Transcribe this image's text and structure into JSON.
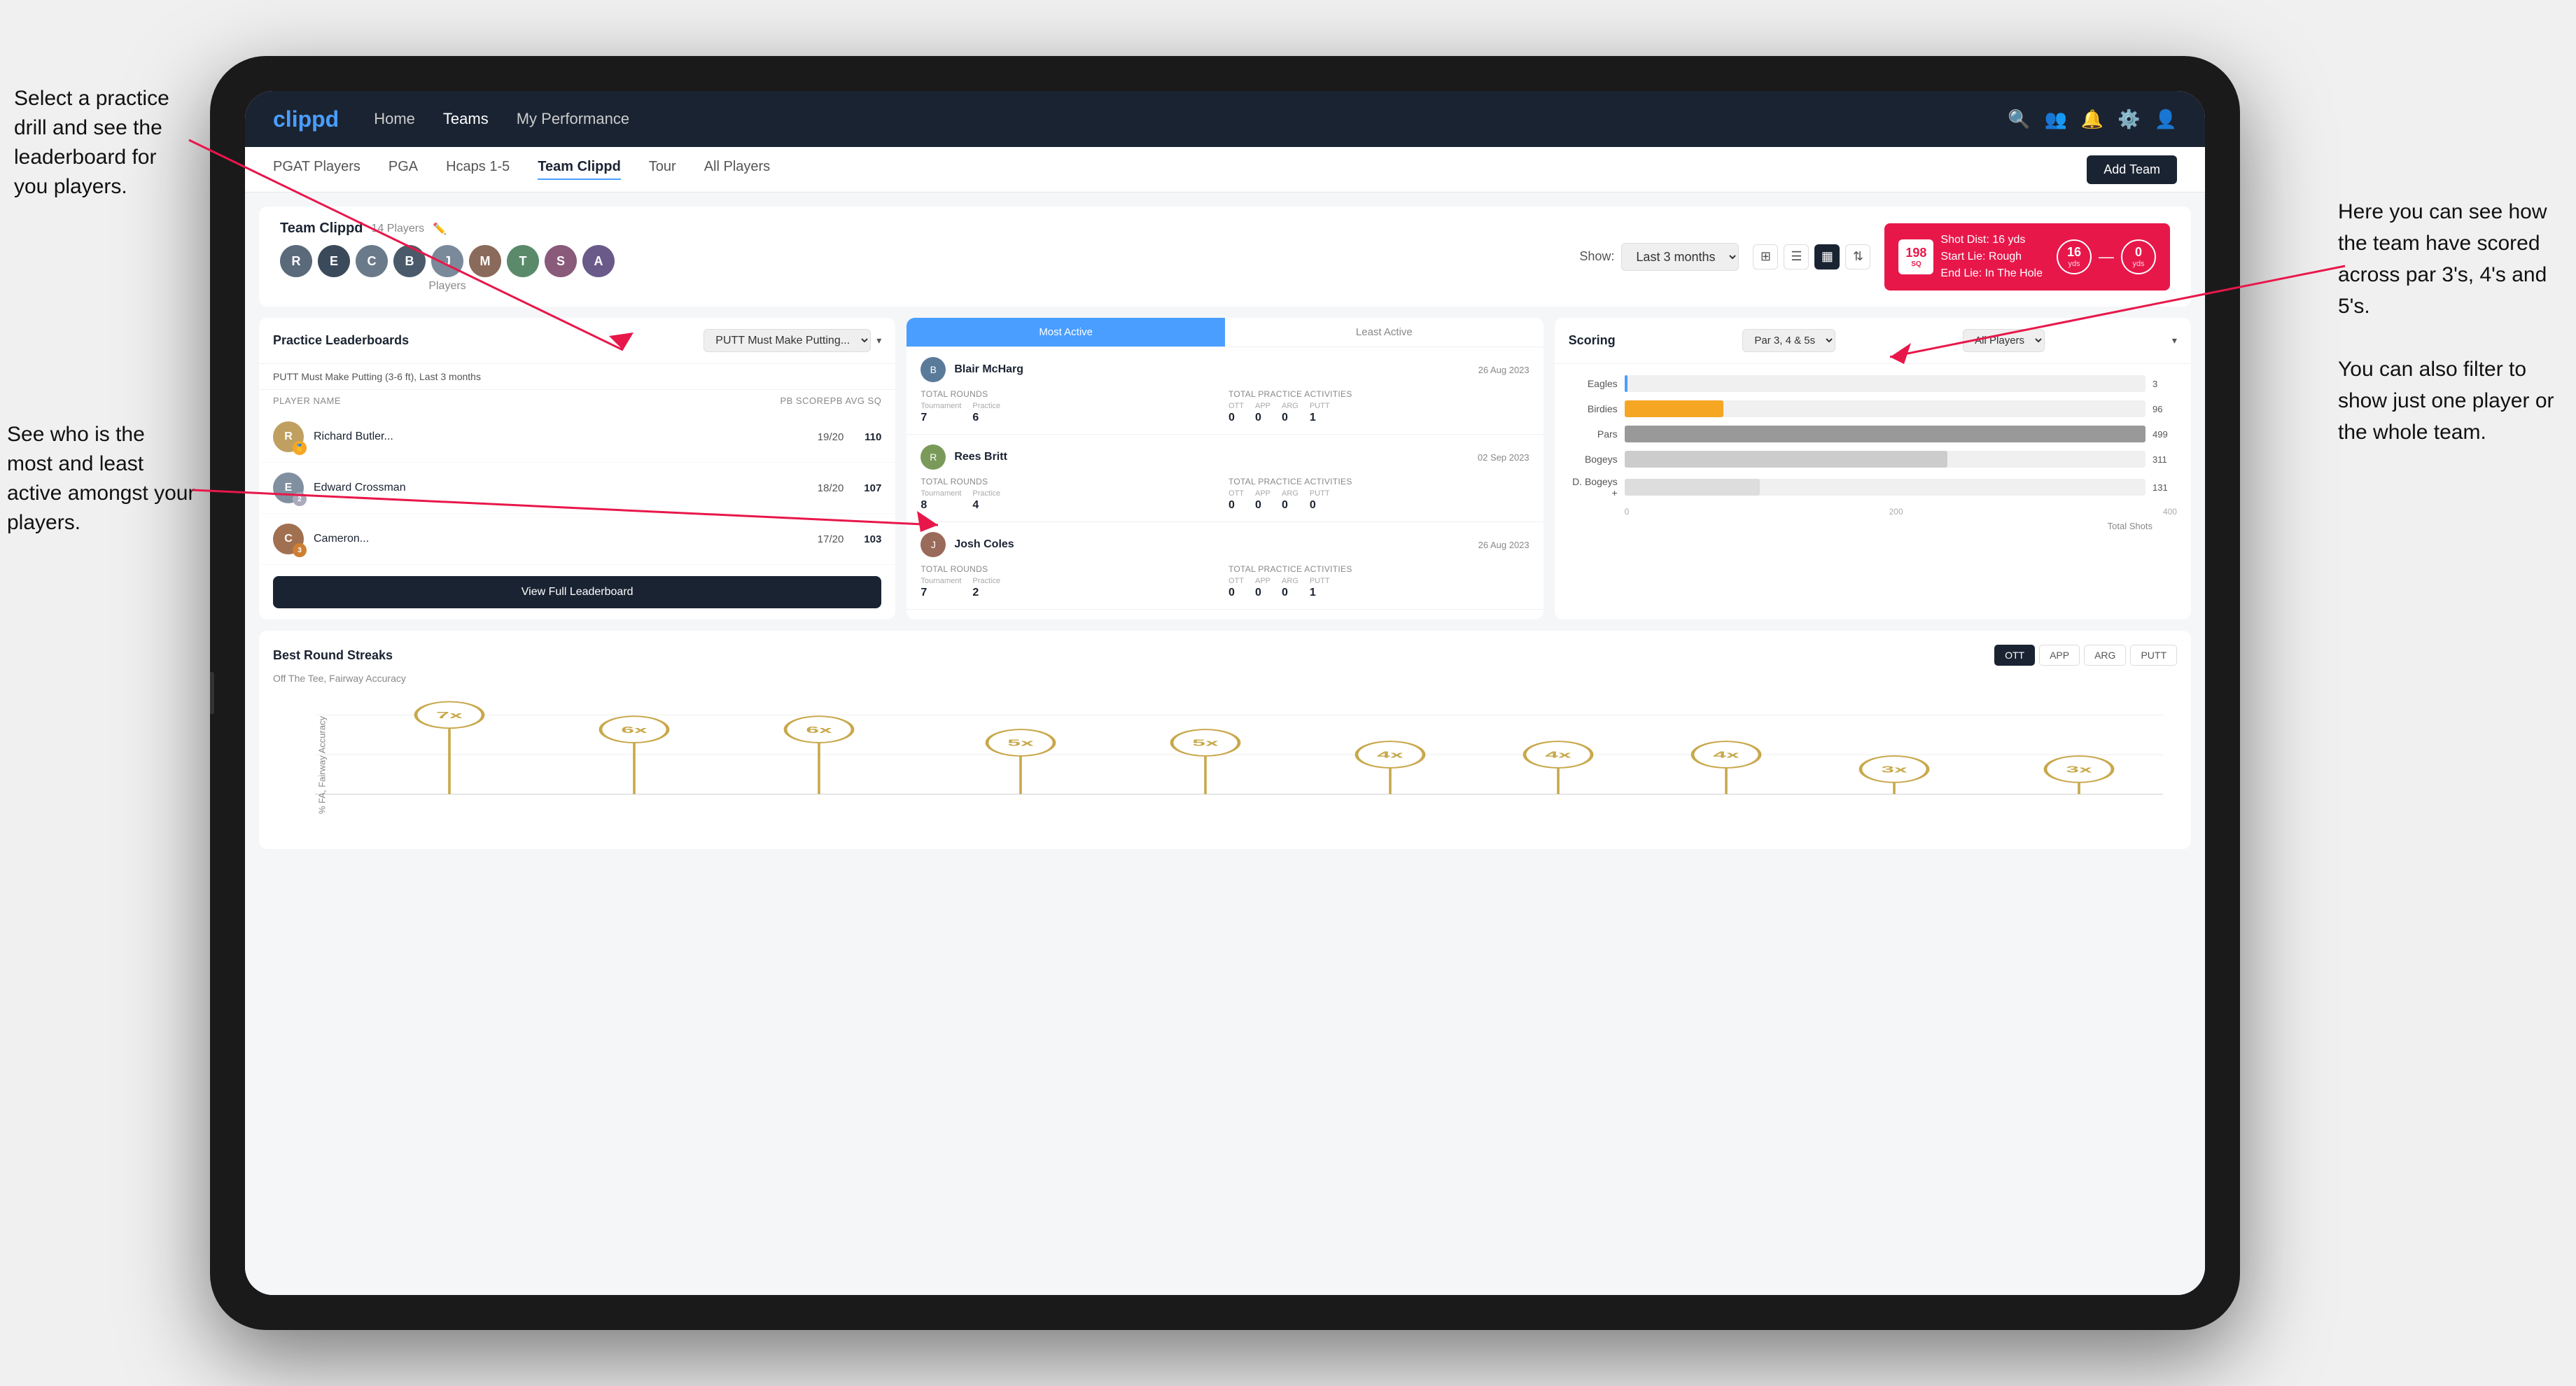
{
  "annotations": {
    "left1": "Select a practice drill and see the leaderboard for you players.",
    "left2": "See who is the most and least active amongst your players.",
    "right1": "Here you can see how the team have scored across par 3's, 4's and 5's.",
    "right2": "You can also filter to show just one player or the whole team."
  },
  "nav": {
    "logo": "clippd",
    "links": [
      "Home",
      "Teams",
      "My Performance"
    ],
    "activeLink": "Teams"
  },
  "subNav": {
    "links": [
      "PGAT Players",
      "PGA",
      "Hcaps 1-5",
      "Team Clippd",
      "Tour",
      "All Players"
    ],
    "activeLink": "Team Clippd",
    "addTeamLabel": "Add Team"
  },
  "team": {
    "title": "Team Clippd",
    "playerCount": "14 Players",
    "showLabel": "Show:",
    "filterValue": "Last 3 months",
    "avatarsLabel": "Players"
  },
  "shotCard": {
    "number": "198",
    "unit": "SQ",
    "details1": "Shot Dist: 16 yds",
    "details2": "Start Lie: Rough",
    "details3": "End Lie: In The Hole",
    "yds1": "16",
    "yds1Label": "yds",
    "yds2": "0",
    "yds2Label": "yds"
  },
  "practiceLeaderboard": {
    "title": "Practice Leaderboards",
    "drillLabel": "PUTT Must Make Putting...",
    "subtitle": "PUTT Must Make Putting (3-6 ft), Last 3 months",
    "columns": [
      "PLAYER NAME",
      "PB SCORE",
      "PB AVG SQ"
    ],
    "players": [
      {
        "name": "Richard Butler...",
        "score": "19/20",
        "avg": "110",
        "badgeClass": "badge-gold",
        "badgeNum": "🥇"
      },
      {
        "name": "Edward Crossman",
        "score": "18/20",
        "avg": "107",
        "badgeClass": "badge-silver",
        "badgeNum": "2"
      },
      {
        "name": "Cameron...",
        "score": "17/20",
        "avg": "103",
        "badgeClass": "badge-bronze",
        "badgeNum": "3"
      }
    ],
    "viewFullLabel": "View Full Leaderboard"
  },
  "mostActive": {
    "tabActive": "Most Active",
    "tabLeast": "Least Active",
    "players": [
      {
        "name": "Blair McHarg",
        "date": "26 Aug 2023",
        "totalRoundsLabel": "Total Rounds",
        "tournament": "7",
        "practice": "6",
        "tournamentLabel": "Tournament",
        "practiceLabel": "Practice",
        "practiceActivitiesLabel": "Total Practice Activities",
        "ott": "0",
        "app": "0",
        "arg": "0",
        "putt": "1",
        "ottLabel": "OTT",
        "appLabel": "APP",
        "argLabel": "ARG",
        "puttLabel": "PUTT"
      },
      {
        "name": "Rees Britt",
        "date": "02 Sep 2023",
        "totalRoundsLabel": "Total Rounds",
        "tournament": "8",
        "practice": "4",
        "tournamentLabel": "Tournament",
        "practiceLabel": "Practice",
        "practiceActivitiesLabel": "Total Practice Activities",
        "ott": "0",
        "app": "0",
        "arg": "0",
        "putt": "0",
        "ottLabel": "OTT",
        "appLabel": "APP",
        "argLabel": "ARG",
        "puttLabel": "PUTT"
      },
      {
        "name": "Josh Coles",
        "date": "26 Aug 2023",
        "totalRoundsLabel": "Total Rounds",
        "tournament": "7",
        "practice": "2",
        "tournamentLabel": "Tournament",
        "practiceLabel": "Practice",
        "practiceActivitiesLabel": "Total Practice Activities",
        "ott": "0",
        "app": "0",
        "arg": "0",
        "putt": "1",
        "ottLabel": "OTT",
        "appLabel": "APP",
        "argLabel": "ARG",
        "puttLabel": "PUTT"
      }
    ]
  },
  "scoring": {
    "title": "Scoring",
    "filterLabel": "Par 3, 4 & 5s",
    "playersLabel": "All Players",
    "bars": [
      {
        "label": "Eagles",
        "value": 3,
        "maxValue": 499,
        "colorClass": "eagles",
        "displayValue": "3"
      },
      {
        "label": "Birdies",
        "value": 96,
        "maxValue": 499,
        "colorClass": "birdies",
        "displayValue": "96"
      },
      {
        "label": "Pars",
        "value": 499,
        "maxValue": 499,
        "colorClass": "pars",
        "displayValue": "499"
      },
      {
        "label": "Bogeys",
        "value": 311,
        "maxValue": 499,
        "colorClass": "bogeys",
        "displayValue": "311"
      },
      {
        "label": "D. Bogeys +",
        "value": 131,
        "maxValue": 499,
        "colorClass": "dbogeys",
        "displayValue": "131"
      }
    ],
    "xAxisLabels": [
      "0",
      "200",
      "400"
    ],
    "xAxisTitle": "Total Shots"
  },
  "bestRoundStreaks": {
    "title": "Best Round Streaks",
    "subtitle": "Off The Tee, Fairway Accuracy",
    "filterButtons": [
      "OTT",
      "APP",
      "ARG",
      "PUTT"
    ],
    "activeFilter": "OTT",
    "streakPoints": [
      {
        "x": 6,
        "label": "7x",
        "height": 140
      },
      {
        "x": 12,
        "label": "6x",
        "height": 110
      },
      {
        "x": 18,
        "label": "6x",
        "height": 110
      },
      {
        "x": 25,
        "label": "5x",
        "height": 85
      },
      {
        "x": 31,
        "label": "5x",
        "height": 85
      },
      {
        "x": 38,
        "label": "4x",
        "height": 65
      },
      {
        "x": 45,
        "label": "4x",
        "height": 65
      },
      {
        "x": 52,
        "label": "4x",
        "height": 65
      },
      {
        "x": 59,
        "label": "3x",
        "height": 45
      },
      {
        "x": 66,
        "label": "3x",
        "height": 45
      }
    ]
  }
}
